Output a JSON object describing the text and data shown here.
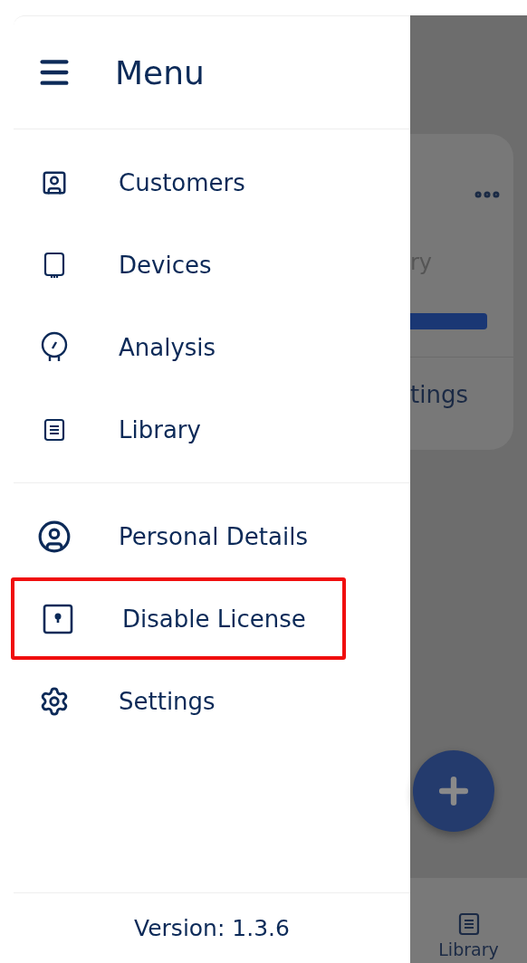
{
  "drawer": {
    "title": "Menu",
    "groups": [
      [
        {
          "label": "Customers",
          "highlighted": false
        },
        {
          "label": "Devices",
          "highlighted": false
        },
        {
          "label": "Analysis",
          "highlighted": false
        },
        {
          "label": "Library",
          "highlighted": false
        }
      ],
      [
        {
          "label": "Personal Details",
          "highlighted": false
        },
        {
          "label": "Disable License",
          "highlighted": true
        },
        {
          "label": "Settings",
          "highlighted": false
        }
      ]
    ],
    "version": "Version: 1.3.6"
  },
  "background": {
    "card": {
      "subtitle": "ry",
      "progress": {
        "level": 1
      },
      "action": "tings"
    },
    "bottom_nav": [
      {
        "label": "Library"
      }
    ]
  }
}
